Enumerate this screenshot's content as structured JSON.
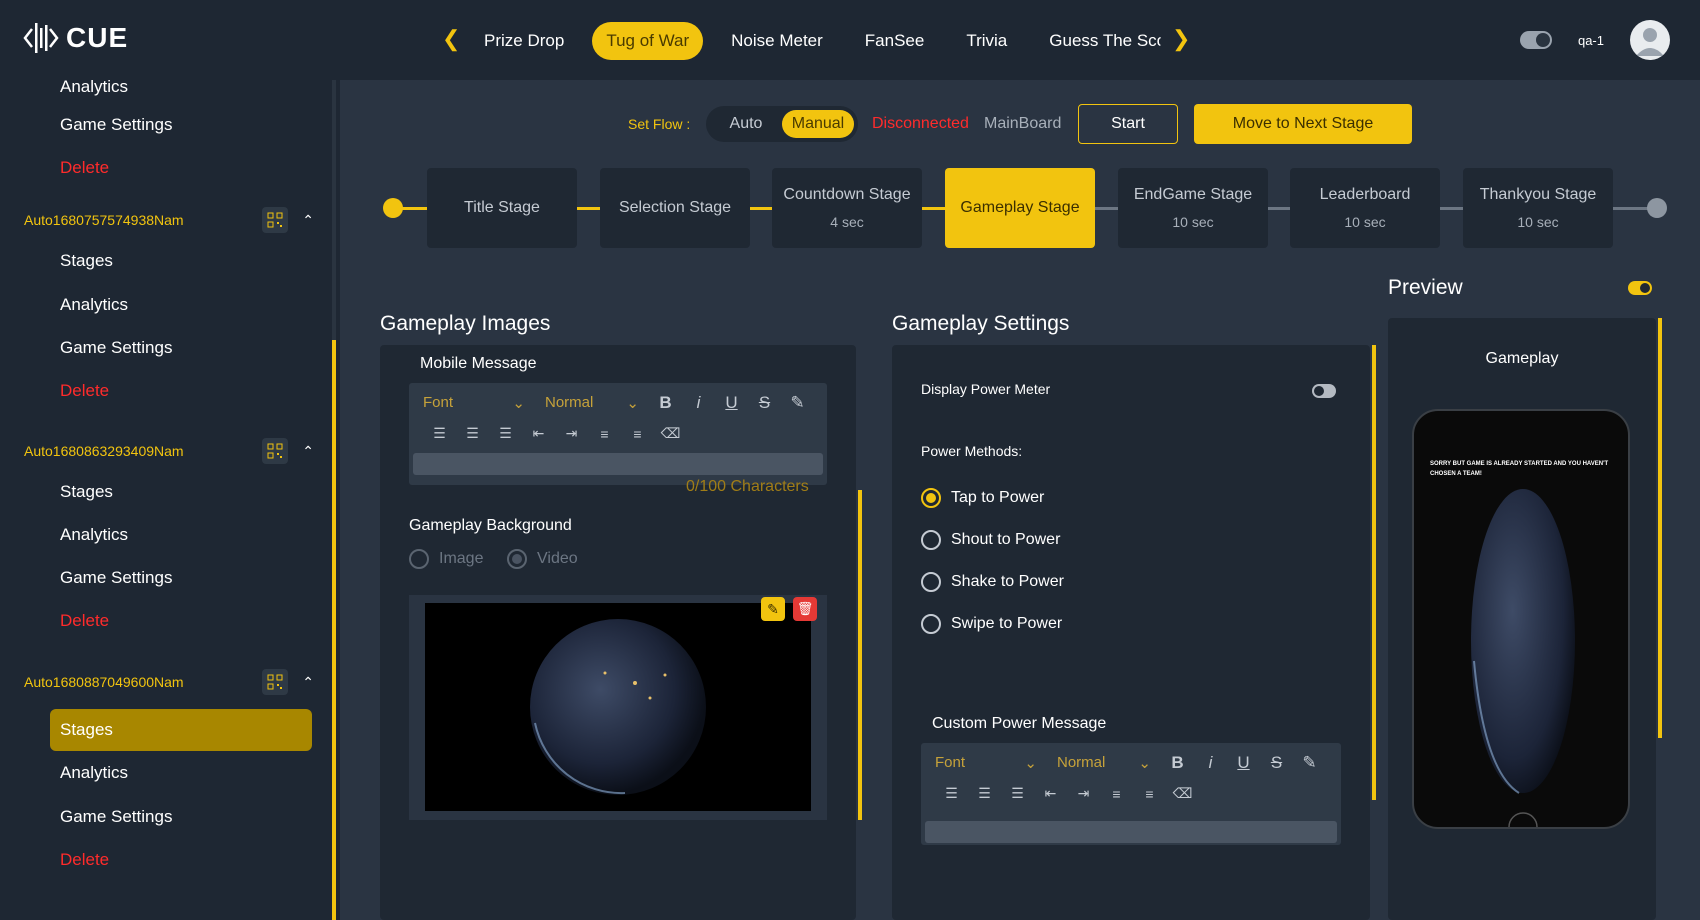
{
  "app": {
    "logo_text": "CUE",
    "user_name": "qa-1"
  },
  "game_tabs": [
    "Prize Drop",
    "Tug of War",
    "Noise Meter",
    "FanSee",
    "Trivia",
    "Guess The Sco"
  ],
  "active_tab": "Tug of War",
  "sidebar": {
    "top_partial": "Analytics",
    "top_items": [
      "Game Settings",
      "Delete"
    ],
    "groups": [
      {
        "name": "Auto1680757574938Nam",
        "items": [
          "Stages",
          "Analytics",
          "Game Settings",
          "Delete"
        ]
      },
      {
        "name": "Auto1680863293409Nam",
        "items": [
          "Stages",
          "Analytics",
          "Game Settings",
          "Delete"
        ]
      },
      {
        "name": "Auto1680887049600Nam",
        "items": [
          "Stages",
          "Analytics",
          "Game Settings",
          "Delete"
        ],
        "active_item": "Stages"
      }
    ]
  },
  "flow": {
    "label": "Set Flow :",
    "options": [
      "Auto",
      "Manual"
    ],
    "selected": "Manual",
    "status_disconnected": "Disconnected",
    "status_board": "MainBoard",
    "start_label": "Start",
    "next_label": "Move to Next Stage"
  },
  "stages": [
    {
      "name": "Title Stage",
      "duration": ""
    },
    {
      "name": "Selection Stage",
      "duration": ""
    },
    {
      "name": "Countdown Stage",
      "duration": "4 sec"
    },
    {
      "name": "Gameplay Stage",
      "duration": "",
      "active": true
    },
    {
      "name": "EndGame Stage",
      "duration": "10 sec"
    },
    {
      "name": "Leaderboard",
      "duration": "10 sec"
    },
    {
      "name": "Thankyou Stage",
      "duration": "10 sec"
    }
  ],
  "gameplay_images": {
    "title": "Gameplay Images",
    "mobile_message_label": "Mobile Message",
    "font_placeholder": "Font",
    "size_placeholder": "Normal",
    "char_count": "0/100 Characters",
    "background_label": "Gameplay Background",
    "background_options": [
      "Image",
      "Video"
    ]
  },
  "gameplay_settings": {
    "title": "Gameplay Settings",
    "display_power_meter_label": "Display Power Meter",
    "power_methods_label": "Power Methods:",
    "power_methods": [
      "Tap to Power",
      "Shout to Power",
      "Shake to Power",
      "Swipe to Power"
    ],
    "selected_method": "Tap to Power",
    "custom_message_label": "Custom Power Message",
    "font_placeholder": "Font",
    "size_placeholder": "Normal"
  },
  "preview": {
    "title": "Preview",
    "screen_title": "Gameplay",
    "phone_message": "Sorry but game is already started and you haven't chosen a team!"
  },
  "colors": {
    "accent": "#f2c40f",
    "danger": "#ff2b2b",
    "bg": "#1e2733",
    "panel": "#1f2833"
  }
}
